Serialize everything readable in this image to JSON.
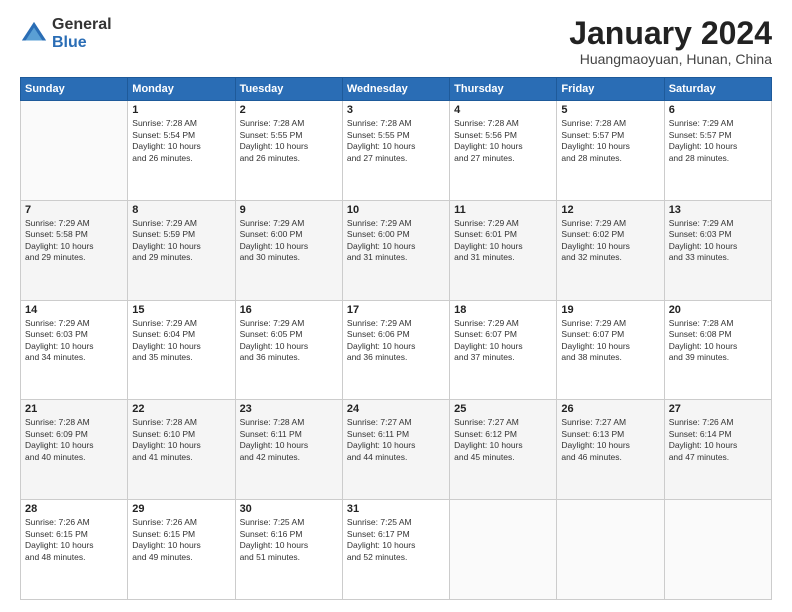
{
  "logo": {
    "general": "General",
    "blue": "Blue"
  },
  "title": "January 2024",
  "subtitle": "Huangmaoyuan, Hunan, China",
  "days_header": [
    "Sunday",
    "Monday",
    "Tuesday",
    "Wednesday",
    "Thursday",
    "Friday",
    "Saturday"
  ],
  "weeks": [
    [
      {
        "num": "",
        "info": ""
      },
      {
        "num": "1",
        "info": "Sunrise: 7:28 AM\nSunset: 5:54 PM\nDaylight: 10 hours\nand 26 minutes."
      },
      {
        "num": "2",
        "info": "Sunrise: 7:28 AM\nSunset: 5:55 PM\nDaylight: 10 hours\nand 26 minutes."
      },
      {
        "num": "3",
        "info": "Sunrise: 7:28 AM\nSunset: 5:55 PM\nDaylight: 10 hours\nand 27 minutes."
      },
      {
        "num": "4",
        "info": "Sunrise: 7:28 AM\nSunset: 5:56 PM\nDaylight: 10 hours\nand 27 minutes."
      },
      {
        "num": "5",
        "info": "Sunrise: 7:28 AM\nSunset: 5:57 PM\nDaylight: 10 hours\nand 28 minutes."
      },
      {
        "num": "6",
        "info": "Sunrise: 7:29 AM\nSunset: 5:57 PM\nDaylight: 10 hours\nand 28 minutes."
      }
    ],
    [
      {
        "num": "7",
        "info": "Sunrise: 7:29 AM\nSunset: 5:58 PM\nDaylight: 10 hours\nand 29 minutes."
      },
      {
        "num": "8",
        "info": "Sunrise: 7:29 AM\nSunset: 5:59 PM\nDaylight: 10 hours\nand 29 minutes."
      },
      {
        "num": "9",
        "info": "Sunrise: 7:29 AM\nSunset: 6:00 PM\nDaylight: 10 hours\nand 30 minutes."
      },
      {
        "num": "10",
        "info": "Sunrise: 7:29 AM\nSunset: 6:00 PM\nDaylight: 10 hours\nand 31 minutes."
      },
      {
        "num": "11",
        "info": "Sunrise: 7:29 AM\nSunset: 6:01 PM\nDaylight: 10 hours\nand 31 minutes."
      },
      {
        "num": "12",
        "info": "Sunrise: 7:29 AM\nSunset: 6:02 PM\nDaylight: 10 hours\nand 32 minutes."
      },
      {
        "num": "13",
        "info": "Sunrise: 7:29 AM\nSunset: 6:03 PM\nDaylight: 10 hours\nand 33 minutes."
      }
    ],
    [
      {
        "num": "14",
        "info": "Sunrise: 7:29 AM\nSunset: 6:03 PM\nDaylight: 10 hours\nand 34 minutes."
      },
      {
        "num": "15",
        "info": "Sunrise: 7:29 AM\nSunset: 6:04 PM\nDaylight: 10 hours\nand 35 minutes."
      },
      {
        "num": "16",
        "info": "Sunrise: 7:29 AM\nSunset: 6:05 PM\nDaylight: 10 hours\nand 36 minutes."
      },
      {
        "num": "17",
        "info": "Sunrise: 7:29 AM\nSunset: 6:06 PM\nDaylight: 10 hours\nand 36 minutes."
      },
      {
        "num": "18",
        "info": "Sunrise: 7:29 AM\nSunset: 6:07 PM\nDaylight: 10 hours\nand 37 minutes."
      },
      {
        "num": "19",
        "info": "Sunrise: 7:29 AM\nSunset: 6:07 PM\nDaylight: 10 hours\nand 38 minutes."
      },
      {
        "num": "20",
        "info": "Sunrise: 7:28 AM\nSunset: 6:08 PM\nDaylight: 10 hours\nand 39 minutes."
      }
    ],
    [
      {
        "num": "21",
        "info": "Sunrise: 7:28 AM\nSunset: 6:09 PM\nDaylight: 10 hours\nand 40 minutes."
      },
      {
        "num": "22",
        "info": "Sunrise: 7:28 AM\nSunset: 6:10 PM\nDaylight: 10 hours\nand 41 minutes."
      },
      {
        "num": "23",
        "info": "Sunrise: 7:28 AM\nSunset: 6:11 PM\nDaylight: 10 hours\nand 42 minutes."
      },
      {
        "num": "24",
        "info": "Sunrise: 7:27 AM\nSunset: 6:11 PM\nDaylight: 10 hours\nand 44 minutes."
      },
      {
        "num": "25",
        "info": "Sunrise: 7:27 AM\nSunset: 6:12 PM\nDaylight: 10 hours\nand 45 minutes."
      },
      {
        "num": "26",
        "info": "Sunrise: 7:27 AM\nSunset: 6:13 PM\nDaylight: 10 hours\nand 46 minutes."
      },
      {
        "num": "27",
        "info": "Sunrise: 7:26 AM\nSunset: 6:14 PM\nDaylight: 10 hours\nand 47 minutes."
      }
    ],
    [
      {
        "num": "28",
        "info": "Sunrise: 7:26 AM\nSunset: 6:15 PM\nDaylight: 10 hours\nand 48 minutes."
      },
      {
        "num": "29",
        "info": "Sunrise: 7:26 AM\nSunset: 6:15 PM\nDaylight: 10 hours\nand 49 minutes."
      },
      {
        "num": "30",
        "info": "Sunrise: 7:25 AM\nSunset: 6:16 PM\nDaylight: 10 hours\nand 51 minutes."
      },
      {
        "num": "31",
        "info": "Sunrise: 7:25 AM\nSunset: 6:17 PM\nDaylight: 10 hours\nand 52 minutes."
      },
      {
        "num": "",
        "info": ""
      },
      {
        "num": "",
        "info": ""
      },
      {
        "num": "",
        "info": ""
      }
    ]
  ]
}
